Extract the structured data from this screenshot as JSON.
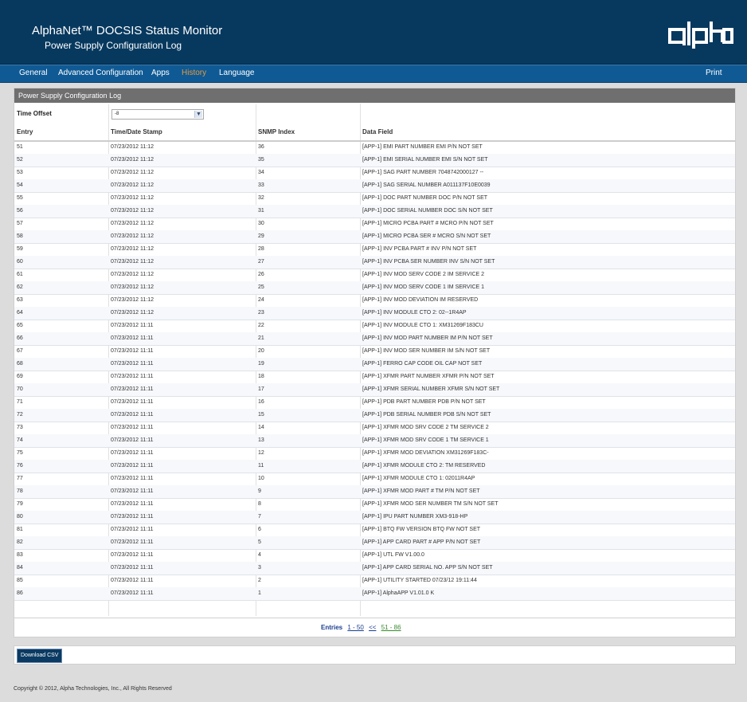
{
  "header": {
    "title": "AlphaNet™ DOCSIS Status Monitor",
    "subtitle": "Power Supply Configuration Log",
    "logo_text": "alpha"
  },
  "nav": {
    "items": [
      {
        "label": "General"
      },
      {
        "label": "Advanced Configuration"
      },
      {
        "label": "Apps"
      },
      {
        "label": "History",
        "active": true
      },
      {
        "label": "Language"
      }
    ],
    "print_label": "Print",
    "active_color": "#e59a3b"
  },
  "panel": {
    "title": "Power Supply Configuration Log",
    "time_offset_label": "Time Offset",
    "time_offset_value": "-8"
  },
  "table": {
    "headers": [
      "Entry",
      "Time/Date Stamp",
      "SNMP Index",
      "Data Field"
    ],
    "rows": [
      [
        "51",
        "07/23/2012 11:12",
        "36",
        "[APP-1] EMI PART NUMBER EMI P/N NOT SET"
      ],
      [
        "52",
        "07/23/2012 11:12",
        "35",
        "[APP-1] EMI SERIAL NUMBER EMI S/N NOT SET"
      ],
      [
        "53",
        "07/23/2012 11:12",
        "34",
        "[APP-1] SAG PART NUMBER 7048742000127 --"
      ],
      [
        "54",
        "07/23/2012 11:12",
        "33",
        "[APP-1] SAG SERIAL NUMBER A011137F10E0039"
      ],
      [
        "55",
        "07/23/2012 11:12",
        "32",
        "[APP-1] DOC PART NUMBER DOC P/N NOT SET"
      ],
      [
        "56",
        "07/23/2012 11:12",
        "31",
        "[APP-1] DOC SERIAL NUMBER DOC S/N NOT SET"
      ],
      [
        "57",
        "07/23/2012 11:12",
        "30",
        "[APP-1] MICRO PCBA PART # MCRO P/N NOT SET"
      ],
      [
        "58",
        "07/23/2012 11:12",
        "29",
        "[APP-1] MICRO PCBA SER # MCRO S/N NOT SET"
      ],
      [
        "59",
        "07/23/2012 11:12",
        "28",
        "[APP-1] INV PCBA PART # INV P/N NOT SET"
      ],
      [
        "60",
        "07/23/2012 11:12",
        "27",
        "[APP-1] INV PCBA SER NUMBER INV S/N NOT SET"
      ],
      [
        "61",
        "07/23/2012 11:12",
        "26",
        "[APP-1] INV MOD SERV CODE 2 IM SERVICE 2"
      ],
      [
        "62",
        "07/23/2012 11:12",
        "25",
        "[APP-1] INV MOD SERV CODE 1 IM SERVICE 1"
      ],
      [
        "63",
        "07/23/2012 11:12",
        "24",
        "[APP-1] INV MOD DEVIATION IM RESERVED"
      ],
      [
        "64",
        "07/23/2012 11:12",
        "23",
        "[APP-1] INV MODULE CTO 2: 02--1R4AP"
      ],
      [
        "65",
        "07/23/2012 11:11",
        "22",
        "[APP-1] INV MODULE CTO 1: XM31269F183CU"
      ],
      [
        "66",
        "07/23/2012 11:11",
        "21",
        "[APP-1] INV MOD PART NUMBER IM P/N NOT SET"
      ],
      [
        "67",
        "07/23/2012 11:11",
        "20",
        "[APP-1] INV MOD SER NUMBER IM S/N NOT SET"
      ],
      [
        "68",
        "07/23/2012 11:11",
        "19",
        "[APP-1] FERRO CAP CODE OIL CAP NOT SET"
      ],
      [
        "69",
        "07/23/2012 11:11",
        "18",
        "[APP-1] XFMR PART NUMBER XFMR P/N NOT SET"
      ],
      [
        "70",
        "07/23/2012 11:11",
        "17",
        "[APP-1] XFMR SERIAL NUMBER XFMR S/N NOT SET"
      ],
      [
        "71",
        "07/23/2012 11:11",
        "16",
        "[APP-1] PDB PART NUMBER PDB P/N NOT SET"
      ],
      [
        "72",
        "07/23/2012 11:11",
        "15",
        "[APP-1] PDB SERIAL NUMBER PDB S/N NOT SET"
      ],
      [
        "73",
        "07/23/2012 11:11",
        "14",
        "[APP-1] XFMR MOD SRV CODE 2 TM SERVICE 2"
      ],
      [
        "74",
        "07/23/2012 11:11",
        "13",
        "[APP-1] XFMR MOD SRV CODE 1 TM SERVICE 1"
      ],
      [
        "75",
        "07/23/2012 11:11",
        "12",
        "[APP-1] XFMR MOD DEVIATION XM31269F183C-"
      ],
      [
        "76",
        "07/23/2012 11:11",
        "11",
        "[APP-1] XFMR MODULE CTO 2: TM RESERVED"
      ],
      [
        "77",
        "07/23/2012 11:11",
        "10",
        "[APP-1] XFMR MODULE CTO 1: 02011R4AP"
      ],
      [
        "78",
        "07/23/2012 11:11",
        "9",
        "[APP-1] XFMR MOD PART # TM P/N NOT SET"
      ],
      [
        "79",
        "07/23/2012 11:11",
        "8",
        "[APP-1] XFMR MOD SER NUMBER TM S/N NOT SET"
      ],
      [
        "80",
        "07/23/2012 11:11",
        "7",
        "[APP-1] IPU PART NUMBER XM3-918-HP"
      ],
      [
        "81",
        "07/23/2012 11:11",
        "6",
        "[APP-1] BTQ FW VERSION BTQ FW NOT SET"
      ],
      [
        "82",
        "07/23/2012 11:11",
        "5",
        "[APP-1] APP CARD PART # APP P/N NOT SET"
      ],
      [
        "83",
        "07/23/2012 11:11",
        "4",
        "[APP-1] UTL FW V1.00.0"
      ],
      [
        "84",
        "07/23/2012 11:11",
        "3",
        "[APP-1] APP CARD SERIAL NO. APP S/N NOT SET"
      ],
      [
        "85",
        "07/23/2012 11:11",
        "2",
        "[APP-1] UTILITY STARTED 07/23/12 19:11:44"
      ],
      [
        "86",
        "07/23/2012 11:11",
        "1",
        "[APP-1] AlphaAPP V1.01.0 K"
      ]
    ]
  },
  "pagination": {
    "label": "Entries",
    "links": [
      "1 - 50",
      "<<",
      "51 - 86"
    ]
  },
  "download_label": "Download CSV",
  "copyright": "Copyright © 2012, Alpha Technologies, Inc., All Rights Reserved"
}
